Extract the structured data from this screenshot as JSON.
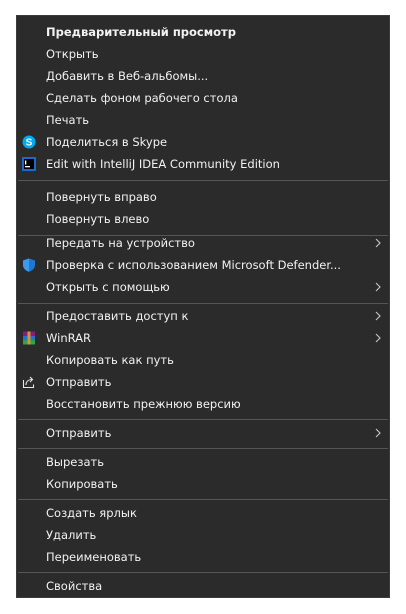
{
  "menu": {
    "items": [
      {
        "label": "Предварительный просмотр"
      },
      {
        "label": "Открыть"
      },
      {
        "label": "Добавить в Веб-альбомы..."
      },
      {
        "label": "Сделать фоном рабочего стола"
      },
      {
        "label": "Печать"
      },
      {
        "label": "Поделиться в Skype",
        "icon": "skype-icon"
      },
      {
        "label": "Edit with IntelliJ IDEA Community Edition",
        "icon": "intellij-idea-icon"
      },
      {
        "label": "Повернуть вправо"
      },
      {
        "label": "Повернуть влево"
      },
      {
        "label": "Передать на устройство",
        "submenu": true
      },
      {
        "label": "Проверка с использованием Microsoft Defender...",
        "icon": "defender-shield-icon"
      },
      {
        "label": "Открыть с помощью",
        "submenu": true
      },
      {
        "label": "Предоставить доступ к",
        "submenu": true
      },
      {
        "label": "WinRAR",
        "icon": "winrar-icon",
        "submenu": true
      },
      {
        "label": "Копировать как путь"
      },
      {
        "label": "Отправить",
        "icon": "share-icon"
      },
      {
        "label": "Восстановить прежнюю версию"
      },
      {
        "label": "Отправить",
        "submenu": true
      },
      {
        "label": "Вырезать"
      },
      {
        "label": "Копировать"
      },
      {
        "label": "Создать ярлык"
      },
      {
        "label": "Удалить"
      },
      {
        "label": "Переименовать"
      },
      {
        "label": "Свойства"
      }
    ]
  },
  "colors": {
    "background": "#2b2b2b",
    "text": "#f2f2f2",
    "separator": "#555555",
    "skype": "#00a9f0",
    "defender": "#1e78d2"
  }
}
